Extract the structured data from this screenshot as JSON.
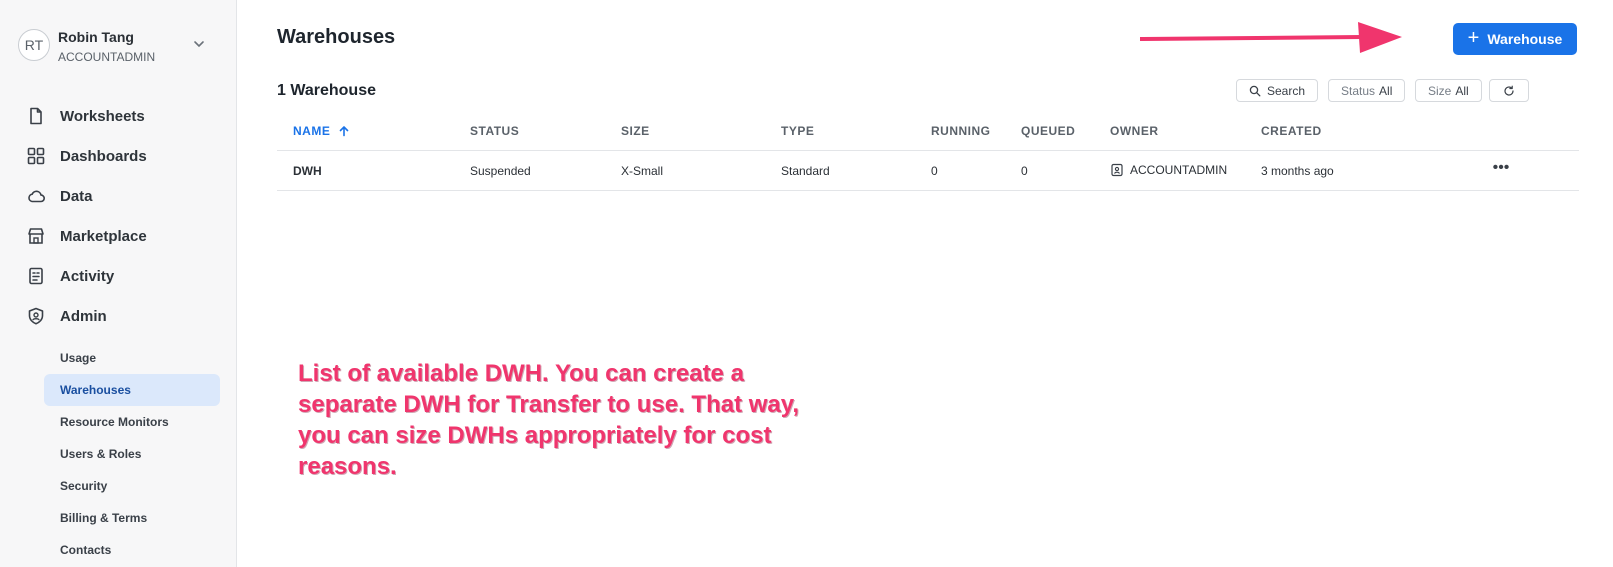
{
  "user": {
    "initials": "RT",
    "name": "Robin Tang",
    "role": "ACCOUNTADMIN"
  },
  "nav": [
    {
      "label": "Worksheets",
      "icon": "worksheet-icon"
    },
    {
      "label": "Dashboards",
      "icon": "dashboard-grid-icon"
    },
    {
      "label": "Data",
      "icon": "cloud-icon"
    },
    {
      "label": "Marketplace",
      "icon": "storefront-icon"
    },
    {
      "label": "Activity",
      "icon": "activity-list-icon"
    },
    {
      "label": "Admin",
      "icon": "shield-icon"
    }
  ],
  "admin_subnav": [
    {
      "label": "Usage",
      "active": false
    },
    {
      "label": "Warehouses",
      "active": true
    },
    {
      "label": "Resource Monitors",
      "active": false
    },
    {
      "label": "Users & Roles",
      "active": false
    },
    {
      "label": "Security",
      "active": false
    },
    {
      "label": "Billing & Terms",
      "active": false
    },
    {
      "label": "Contacts",
      "active": false
    }
  ],
  "header": {
    "title": "Warehouses",
    "add_button": "Warehouse"
  },
  "summary": {
    "count_label": "1 Warehouse"
  },
  "toolbar": {
    "search": "Search",
    "status_label": "Status",
    "status_value": "All",
    "size_label": "Size",
    "size_value": "All"
  },
  "table": {
    "columns": [
      "NAME",
      "STATUS",
      "SIZE",
      "TYPE",
      "RUNNING",
      "QUEUED",
      "OWNER",
      "CREATED"
    ],
    "sorted_column": "NAME",
    "rows": [
      {
        "name": "DWH",
        "status": "Suspended",
        "size": "X-Small",
        "type": "Standard",
        "running": "0",
        "queued": "0",
        "owner": "ACCOUNTADMIN",
        "created": "3 months ago"
      }
    ]
  },
  "annotation": {
    "text": "List of available DWH. You can create a separate DWH for Transfer to use. That way, you can size DWHs appropriately for cost reasons.",
    "color": "#f0356d"
  },
  "colors": {
    "accent": "#1a73e8",
    "active_nav_bg": "#dbe8fb"
  }
}
